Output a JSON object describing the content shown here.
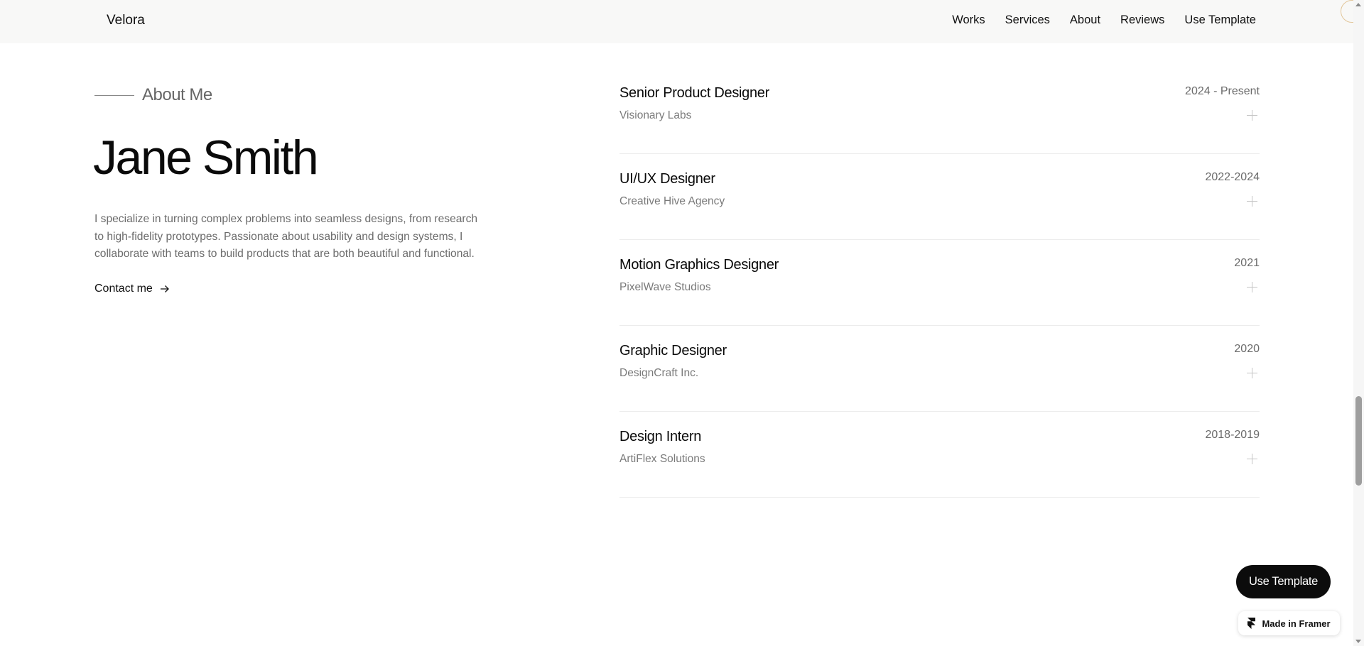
{
  "nav": {
    "logo": "Velora",
    "links": [
      "Works",
      "Services",
      "About",
      "Reviews",
      "Use Template"
    ]
  },
  "about": {
    "section_label": "About Me",
    "name": "Jane Smith",
    "bio": "I specialize in turning complex problems into seamless designs, from research to high-fidelity prototypes. Passionate about usability and design systems, I collaborate with teams to build products that are both beautiful and functional.",
    "contact_label": "Contact me",
    "contact_icon": "arrow-right-icon"
  },
  "experience": [
    {
      "role": "Senior Product Designer",
      "company": "Visionary Labs",
      "date": "2024 - Present"
    },
    {
      "role": "UI/UX Designer",
      "company": "Creative Hive Agency",
      "date": "2022-2024"
    },
    {
      "role": "Motion Graphics Designer",
      "company": "PixelWave Studios",
      "date": "2021"
    },
    {
      "role": "Graphic Designer",
      "company": "DesignCraft Inc.",
      "date": "2020"
    },
    {
      "role": "Design Intern",
      "company": "ArtiFlex Solutions",
      "date": "2018-2019"
    }
  ],
  "expand_icon": "plus-icon",
  "floating": {
    "use_template": "Use Template",
    "made_in": "Made in Framer",
    "badge_icon": "framer-logo-icon"
  },
  "colors": {
    "nav_background": "#f8f8f7",
    "button_background": "#0c0c0c",
    "text_primary": "#0a0a0a",
    "text_secondary": "#6b6b6b",
    "accent_circle": "#e2c69a"
  }
}
